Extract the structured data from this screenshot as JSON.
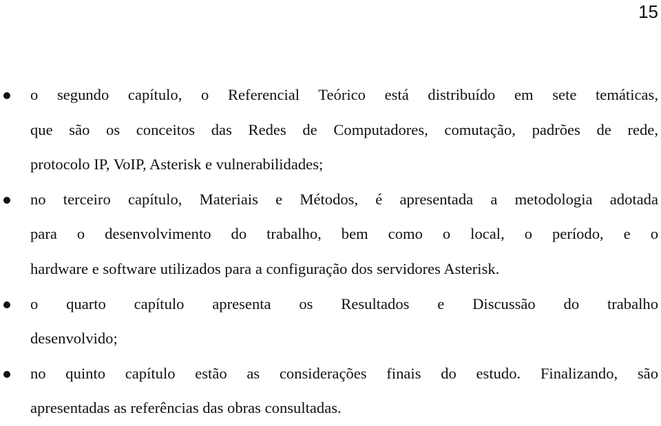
{
  "page": {
    "number": "15"
  },
  "items": [
    {
      "lines": [
        "o segundo capítulo, o Referencial Teórico está distribuído em sete temáticas,",
        "que são os conceitos das Redes de Computadores, comutação, padrões de rede,",
        "protocolo IP, VoIP, Asterisk e vulnerabilidades;"
      ]
    },
    {
      "lines": [
        "no terceiro capítulo, Materiais e Métodos, é apresentada a metodologia adotada",
        "para o desenvolvimento do trabalho, bem como o local, o período, e o",
        "hardware e software utilizados para a configuração dos servidores Asterisk."
      ]
    },
    {
      "lines": [
        "o quarto capítulo apresenta os Resultados e Discussão do trabalho",
        "desenvolvido;"
      ]
    },
    {
      "lines": [
        "no quinto capítulo estão as considerações finais do estudo. Finalizando, são",
        "apresentadas as referências das obras consultadas."
      ]
    }
  ]
}
